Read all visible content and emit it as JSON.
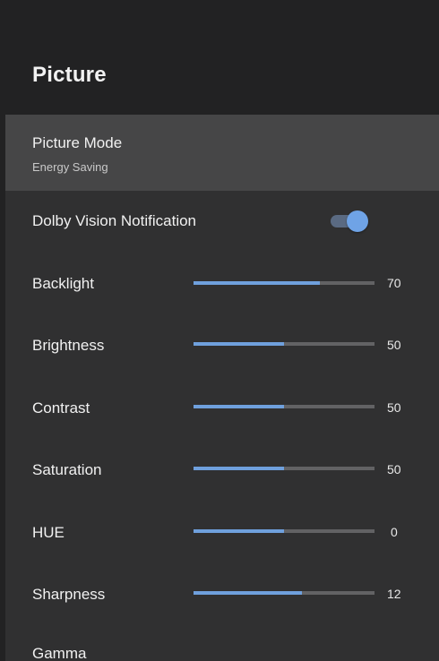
{
  "header": {
    "title": "Picture"
  },
  "items": [
    {
      "label": "Picture Mode",
      "value": "Energy Saving",
      "selected": true
    },
    {
      "label": "Dolby Vision Notification",
      "toggle": true
    },
    {
      "label": "Backlight",
      "slider_value": "70",
      "fill_fraction": 0.7
    },
    {
      "label": "Brightness",
      "slider_value": "50",
      "fill_fraction": 0.5
    },
    {
      "label": "Contrast",
      "slider_value": "50",
      "fill_fraction": 0.5
    },
    {
      "label": "Saturation",
      "slider_value": "50",
      "fill_fraction": 0.5
    },
    {
      "label": "HUE",
      "slider_value": "0",
      "fill_fraction": 0.5
    },
    {
      "label": "Sharpness",
      "slider_value": "12",
      "fill_fraction": 0.6
    },
    {
      "label": "Gamma"
    }
  ],
  "colors": {
    "accent": "#6fa0dd",
    "header_bg": "#222223",
    "panel_bg": "#303031",
    "selected_bg": "#464647",
    "track": "#626264"
  }
}
